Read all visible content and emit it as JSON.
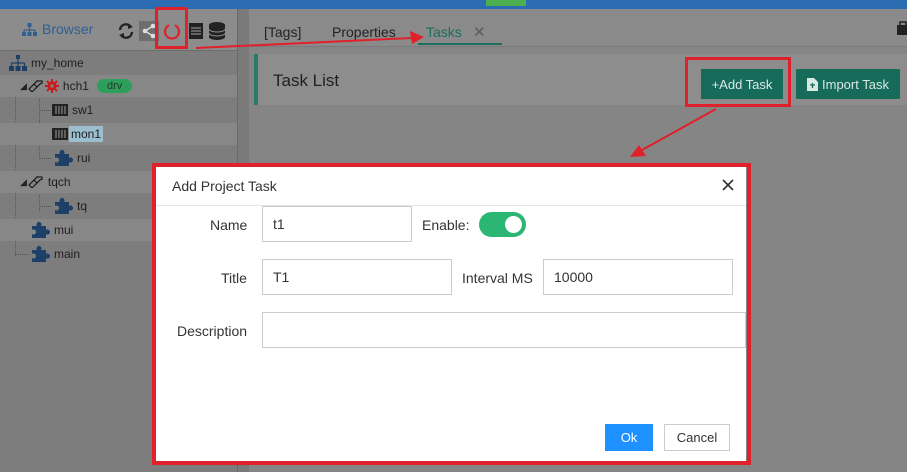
{
  "colors": {
    "accent": "#1f6e5c",
    "toggle_on": "#2bb673",
    "ok_button": "#1e90ff",
    "annotation": "#e0202a",
    "badge": "#2e9e5b"
  },
  "left_panel": {
    "browser_label": "Browser",
    "tools": [
      "refresh-icon",
      "share-icon",
      "power-ring-icon",
      "list-icon",
      "database-icon"
    ]
  },
  "tree": {
    "root": {
      "label": "my_home"
    },
    "hch1": {
      "label": "hch1",
      "badge": "drv"
    },
    "sw1": {
      "label": "sw1"
    },
    "mon1": {
      "label": "mon1"
    },
    "rui": {
      "label": "rui"
    },
    "tqch": {
      "label": "tqch"
    },
    "tq": {
      "label": "tq"
    },
    "mui": {
      "label": "mui"
    },
    "main": {
      "label": "main"
    }
  },
  "tabs": {
    "tags": "[Tags]",
    "properties": "Properties",
    "tasks": "Tasks"
  },
  "task_list": {
    "title": "Task List",
    "add_task": "+Add Task",
    "import_task": "Import Task"
  },
  "modal": {
    "title": "Add Project Task",
    "name_label": "Name",
    "name_value": "t1",
    "enable_label": "Enable:",
    "enabled": true,
    "title_label": "Title",
    "title_value": "T1",
    "interval_label": "Interval MS",
    "interval_value": "10000",
    "description_label": "Description",
    "description_value": "",
    "ok": "Ok",
    "cancel": "Cancel"
  }
}
